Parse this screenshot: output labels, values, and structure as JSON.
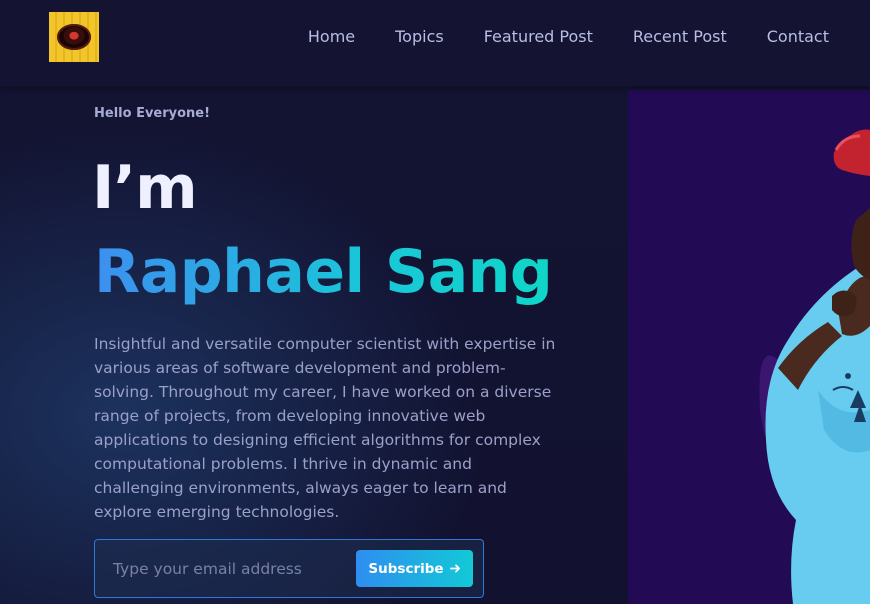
{
  "header": {
    "nav": [
      "Home",
      "Topics",
      "Featured Post",
      "Recent Post",
      "Contact"
    ]
  },
  "hero": {
    "greeting": "Hello Everyone!",
    "intro": "I’m",
    "name": "Raphael Sang",
    "bio": "Insightful and versatile computer scientist with expertise in various areas of software development and problem-solving. Throughout my career, I have worked on a diverse range of projects, from developing innovative web applications to designing efficient algorithms for complex computational problems. I thrive in dynamic and challenging environments, always eager to learn and explore emerging technologies."
  },
  "subscribe": {
    "placeholder": "Type your email address",
    "button_label": "Subscribe",
    "button_icon": "arrow-right-icon"
  },
  "colors": {
    "background": "#121230",
    "header": "#141432",
    "photo_panel": "#230a55",
    "accent_start": "#3d8ff0",
    "accent_end": "#0fd6c8"
  }
}
